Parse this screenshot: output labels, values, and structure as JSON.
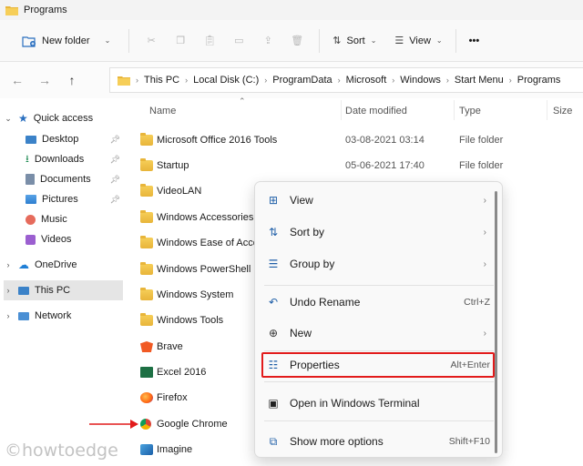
{
  "window": {
    "title": "Programs"
  },
  "toolbar": {
    "new_label": "New folder",
    "sort_label": "Sort",
    "view_label": "View",
    "more_label": "•••"
  },
  "address": {
    "crumbs": [
      "This PC",
      "Local Disk (C:)",
      "ProgramData",
      "Microsoft",
      "Windows",
      "Start Menu",
      "Programs"
    ]
  },
  "sidebar": {
    "quick_access": "Quick access",
    "items": [
      "Desktop",
      "Downloads",
      "Documents",
      "Pictures",
      "Music",
      "Videos"
    ],
    "onedrive": "OneDrive",
    "thispc": "This PC",
    "network": "Network"
  },
  "columns": {
    "name": "Name",
    "date": "Date modified",
    "type": "Type",
    "size": "Size"
  },
  "files": [
    {
      "name": "Microsoft Office 2016 Tools",
      "date": "03-08-2021 03:14",
      "type": "File folder",
      "icon": "folder"
    },
    {
      "name": "Startup",
      "date": "05-06-2021 17:40",
      "type": "File folder",
      "icon": "folder"
    },
    {
      "name": "VideoLAN",
      "icon": "folder"
    },
    {
      "name": "Windows Accessories",
      "icon": "folder"
    },
    {
      "name": "Windows Ease of Access",
      "icon": "folder"
    },
    {
      "name": "Windows PowerShell",
      "icon": "folder"
    },
    {
      "name": "Windows System",
      "icon": "folder"
    },
    {
      "name": "Windows Tools",
      "icon": "folder"
    },
    {
      "name": "Brave",
      "icon": "brave"
    },
    {
      "name": "Excel 2016",
      "icon": "excel"
    },
    {
      "name": "Firefox",
      "icon": "firefox"
    },
    {
      "name": "Google Chrome",
      "icon": "chrome"
    },
    {
      "name": "Imagine",
      "icon": "imagine"
    }
  ],
  "context_menu": {
    "view": "View",
    "sort_by": "Sort by",
    "group_by": "Group by",
    "undo": "Undo Rename",
    "undo_accel": "Ctrl+Z",
    "new": "New",
    "properties": "Properties",
    "properties_accel": "Alt+Enter",
    "terminal": "Open in Windows Terminal",
    "more": "Show more options",
    "more_accel": "Shift+F10"
  },
  "watermark": "©howtoedge",
  "colors": {
    "highlight": "#e21b1b",
    "accent": "#1f5fa8"
  }
}
